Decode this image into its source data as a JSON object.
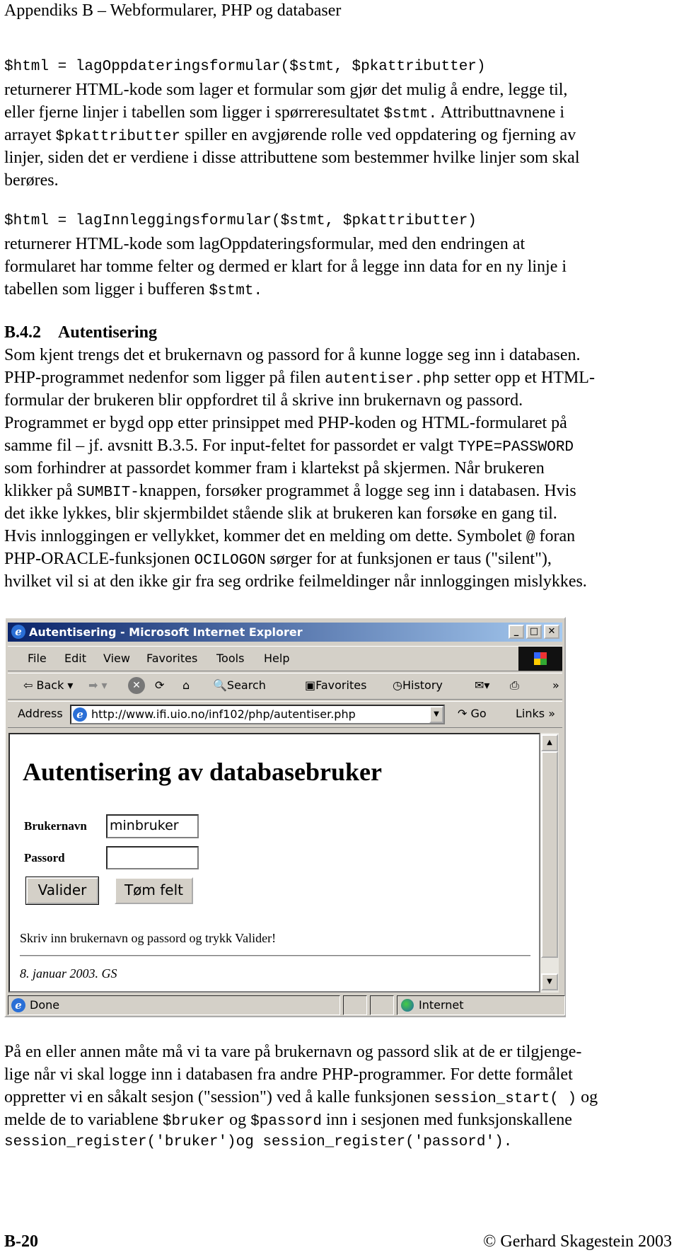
{
  "header": "Appendiks B – Webformularer, PHP og databaser",
  "p1": [
    [
      "$html = lagOppdateringsformular($stmt, $pkattributter)"
    ],
    [
      "returnerer HTML-kode som lager et formular som gjør det mulig å endre, legge til,"
    ],
    [
      "eller fjerne linjer i tabellen som ligger i spørreresultatet ",
      "$stmt.",
      " Attributtnavnene i"
    ],
    [
      "arrayet ",
      "$pkattributter",
      " spiller en avgjørende rolle ved oppdatering og fjerning av"
    ],
    [
      "linjer, siden det er verdiene i disse attributtene som bestemmer hvilke linjer som skal"
    ],
    [
      "berøres."
    ]
  ],
  "p2": [
    [
      "$html = lagInnleggingsformular($stmt, $pkattributter)"
    ],
    [
      "returnerer HTML-kode som lagOppdateringsformular, med den endringen at"
    ],
    [
      "formularet har tomme felter og dermed er klart for å legge inn data for en ny linje i"
    ],
    [
      "tabellen som ligger i bufferen ",
      "$stmt."
    ]
  ],
  "section": {
    "number": "B.4.2",
    "title": "Autentisering"
  },
  "p3": [
    [
      "Som kjent trengs det et brukernavn og passord for å kunne logge seg inn i databasen."
    ],
    [
      "PHP-programmet nedenfor som ligger på filen ",
      "autentiser.php",
      " setter opp et HTML-"
    ],
    [
      "formular der brukeren blir oppfordret til å skrive inn brukernavn og passord."
    ],
    [
      "Programmet er bygd opp etter prinsippet med PHP-koden og HTML-formularet på"
    ],
    [
      "samme fil – jf. avsnitt B.3.5. For input-feltet for passordet er valgt ",
      "TYPE=PASSWORD"
    ],
    [
      "som forhindrer at passordet kommer fram i klartekst på skjermen. Når brukeren"
    ],
    [
      "klikker på ",
      "SUMBIT-",
      "knappen, forsøker programmet å logge seg inn i databasen. Hvis"
    ],
    [
      "det ikke lykkes, blir skjermbildet stående slik at brukeren kan forsøke en gang til."
    ],
    [
      "Hvis innloggingen er vellykket, kommer det en melding om dette. Symbolet ",
      "@",
      " foran"
    ],
    [
      "PHP-ORACLE-funksjonen ",
      "OCILOGON",
      " sørger for at funksjonen er taus (\"silent\"),"
    ],
    [
      "hvilket vil si at den ikke gir fra seg ordrike feilmeldinger når innloggingen mislykkes."
    ]
  ],
  "browser": {
    "title": "Autentisering - Microsoft Internet Explorer",
    "menu": [
      "File",
      "Edit",
      "View",
      "Favorites",
      "Tools",
      "Help"
    ],
    "toolbar": {
      "back": "Back",
      "search": "Search",
      "favorites": "Favorites",
      "history": "History",
      "more": "»"
    },
    "address": {
      "label": "Address",
      "url": "http://www.ifi.uio.no/inf102/php/autentiser.php",
      "go": "Go",
      "links": "Links"
    },
    "page": {
      "heading": "Autentisering av databasebruker",
      "username_label": "Brukernavn",
      "username_value": "minbruker",
      "password_label": "Passord",
      "password_value": "",
      "submit": "Valider",
      "reset": "Tøm felt",
      "message": "Skriv inn brukernavn og passord og trykk Valider!",
      "signature": "8. januar 2003. GS"
    },
    "status": {
      "text": "Done",
      "zone": "Internet"
    },
    "colors": {
      "titlebar_start": "#0a246a",
      "titlebar_end": "#a6caf0",
      "chrome": "#d4d0c8"
    }
  },
  "p4": [
    [
      "På en eller annen måte må vi ta vare på brukernavn og passord slik at de er tilgjenge-"
    ],
    [
      "lige når vi skal logge inn i databasen fra andre PHP-programmer. For dette formålet"
    ],
    [
      "oppretter vi en såkalt sesjon (\"session\") ved å kalle funksjonen ",
      "session_start( )",
      " og"
    ],
    [
      "melde de to variablene ",
      "$bruker",
      " og ",
      "$passord",
      " inn i sesjonen med funksjonskallene"
    ],
    [
      "session_register('bruker')og session_register('passord')."
    ]
  ],
  "footer": {
    "page": "B-20",
    "copyright": "© Gerhard Skagestein 2003"
  }
}
